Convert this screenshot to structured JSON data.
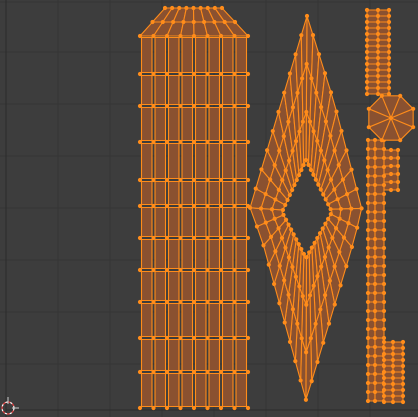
{
  "editor": {
    "name": "UV Editor",
    "background_color": "#3d3d3d",
    "grid_color": "#353535",
    "island_fill_color": "#8a5130",
    "edge_color": "#ff8c1a",
    "vertex_color": "#ff8c1a",
    "selection_state": "all-selected"
  },
  "islands": [
    {
      "id": "tower-column",
      "shape": "tapered-top-column"
    },
    {
      "id": "diamond-blade",
      "shape": "diamond-with-inner-cutout"
    },
    {
      "id": "sword-strip",
      "shape": "thin-vertical-strip"
    },
    {
      "id": "octagon-cap",
      "shape": "octagon"
    },
    {
      "id": "small-top-block",
      "shape": "ladder-block"
    },
    {
      "id": "small-bottom-block",
      "shape": "ladder-block"
    }
  ],
  "cursor": {
    "icon": "2d-cursor-icon"
  }
}
